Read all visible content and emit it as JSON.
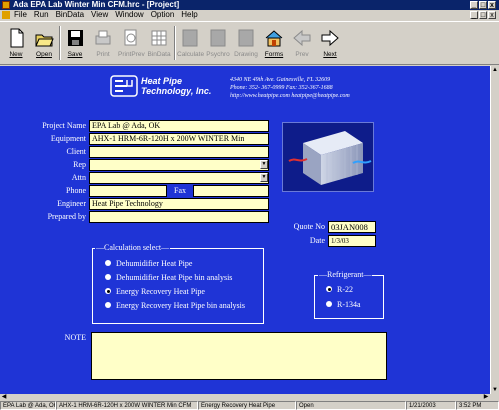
{
  "window": {
    "title": "Ada EPA Lab  Winter Min CFM.hrc - [Project]",
    "controls": [
      "_",
      "□",
      "x"
    ]
  },
  "menu": {
    "items": [
      "File",
      "Run",
      "BinData",
      "View",
      "Window",
      "Option",
      "Help"
    ],
    "controls": [
      "_",
      "□",
      "x"
    ]
  },
  "toolbar": {
    "buttons": [
      {
        "label": "New",
        "icon": "new-document-icon",
        "enabled": true
      },
      {
        "label": "Open",
        "icon": "open-folder-icon",
        "enabled": true
      },
      {
        "label": "Save",
        "icon": "save-disk-icon",
        "enabled": true
      },
      {
        "label": "Print",
        "icon": "print-icon",
        "enabled": false
      },
      {
        "label": "PrintPrev",
        "icon": "print-preview-icon",
        "enabled": false
      },
      {
        "label": "BinData",
        "icon": "bin-data-icon",
        "enabled": false
      },
      {
        "label": "Calculate",
        "icon": "calculate-icon",
        "enabled": false
      },
      {
        "label": "Psychro",
        "icon": "psychro-icon",
        "enabled": false
      },
      {
        "label": "Drawing",
        "icon": "drawing-icon",
        "enabled": false
      },
      {
        "label": "Forms",
        "icon": "forms-house-icon",
        "enabled": true
      },
      {
        "label": "Prev",
        "icon": "arrow-left-icon",
        "enabled": false
      },
      {
        "label": "Next",
        "icon": "arrow-right-icon",
        "enabled": true
      }
    ]
  },
  "company": {
    "name_line1": "Heat Pipe",
    "name_line2": "Technology, Inc.",
    "address": "4340 NE 49th Ave. Gainesville, FL 32609",
    "phone": "Phone: 352- 367-0999  Fax: 352-367-1688",
    "web": "http://www.heatpipe.com   heatpipe@heatpipe.com"
  },
  "form": {
    "project_name": {
      "label": "Project Name",
      "value": "EPA Lab @ Ada, OK"
    },
    "equipment": {
      "label": "Equipment",
      "value": "AHX-1   HRM-6R-120H x 200W   WINTER Min"
    },
    "client": {
      "label": "Client",
      "value": ""
    },
    "rep": {
      "label": "Rep",
      "value": ""
    },
    "attn": {
      "label": "Attn",
      "value": ""
    },
    "phone": {
      "label": "Phone",
      "value": ""
    },
    "fax": {
      "label": "Fax",
      "value": ""
    },
    "engineer": {
      "label": "Engineer",
      "value": "Heat Pipe Technology"
    },
    "prepared_by": {
      "label": "Prepared by",
      "value": ""
    },
    "quote_no": {
      "label": "Quote No",
      "value": "03JAN008"
    },
    "date": {
      "label": "Date",
      "value": "1/3/03"
    },
    "note": {
      "label": "NOTE",
      "value": ""
    }
  },
  "calculation": {
    "title": "Calculation select",
    "options": [
      {
        "label": "Dehumidifier Heat Pipe",
        "selected": false
      },
      {
        "label": "Dehumidifier Heat Pipe bin analysis",
        "selected": false
      },
      {
        "label": "Energy Recovery Heat Pipe",
        "selected": true
      },
      {
        "label": "Energy Recovery Heat Pipe bin analysis",
        "selected": false
      }
    ]
  },
  "refrigerant": {
    "title": "Refrigerant",
    "options": [
      {
        "label": "R-22",
        "selected": true
      },
      {
        "label": "R-134a",
        "selected": false
      }
    ]
  },
  "statusbar": {
    "cells": [
      "EPA Lab @ Ada, OK",
      "AHX-1   HRM-6R-120H x 200W   WINTER Min CFM",
      "Energy Recovery Heat Pipe",
      "Open",
      "1/21/2003",
      "3:52 PM"
    ]
  },
  "colors": {
    "form_background": "#1f34d6",
    "field_background": "#ffffc8",
    "titlebar": "#0a246a"
  }
}
